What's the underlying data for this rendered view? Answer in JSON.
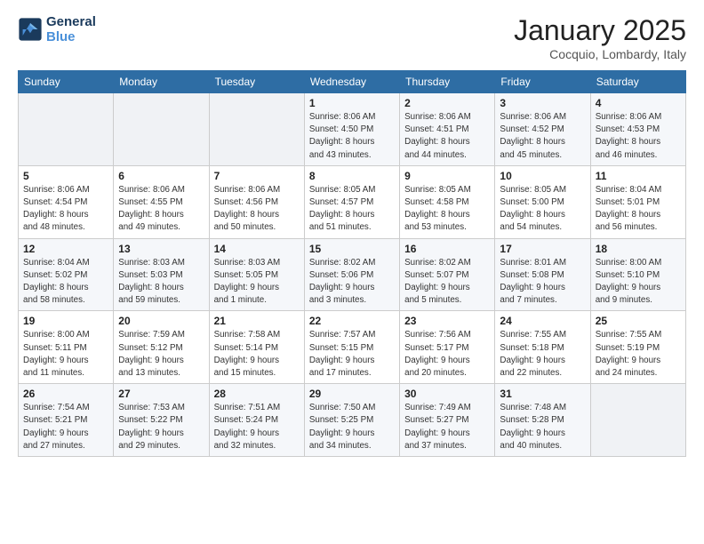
{
  "header": {
    "logo_line1": "General",
    "logo_line2": "Blue",
    "month_title": "January 2025",
    "location": "Cocquio, Lombardy, Italy"
  },
  "weekdays": [
    "Sunday",
    "Monday",
    "Tuesday",
    "Wednesday",
    "Thursday",
    "Friday",
    "Saturday"
  ],
  "weeks": [
    [
      {
        "day": "",
        "info": ""
      },
      {
        "day": "",
        "info": ""
      },
      {
        "day": "",
        "info": ""
      },
      {
        "day": "1",
        "info": "Sunrise: 8:06 AM\nSunset: 4:50 PM\nDaylight: 8 hours\nand 43 minutes."
      },
      {
        "day": "2",
        "info": "Sunrise: 8:06 AM\nSunset: 4:51 PM\nDaylight: 8 hours\nand 44 minutes."
      },
      {
        "day": "3",
        "info": "Sunrise: 8:06 AM\nSunset: 4:52 PM\nDaylight: 8 hours\nand 45 minutes."
      },
      {
        "day": "4",
        "info": "Sunrise: 8:06 AM\nSunset: 4:53 PM\nDaylight: 8 hours\nand 46 minutes."
      }
    ],
    [
      {
        "day": "5",
        "info": "Sunrise: 8:06 AM\nSunset: 4:54 PM\nDaylight: 8 hours\nand 48 minutes."
      },
      {
        "day": "6",
        "info": "Sunrise: 8:06 AM\nSunset: 4:55 PM\nDaylight: 8 hours\nand 49 minutes."
      },
      {
        "day": "7",
        "info": "Sunrise: 8:06 AM\nSunset: 4:56 PM\nDaylight: 8 hours\nand 50 minutes."
      },
      {
        "day": "8",
        "info": "Sunrise: 8:05 AM\nSunset: 4:57 PM\nDaylight: 8 hours\nand 51 minutes."
      },
      {
        "day": "9",
        "info": "Sunrise: 8:05 AM\nSunset: 4:58 PM\nDaylight: 8 hours\nand 53 minutes."
      },
      {
        "day": "10",
        "info": "Sunrise: 8:05 AM\nSunset: 5:00 PM\nDaylight: 8 hours\nand 54 minutes."
      },
      {
        "day": "11",
        "info": "Sunrise: 8:04 AM\nSunset: 5:01 PM\nDaylight: 8 hours\nand 56 minutes."
      }
    ],
    [
      {
        "day": "12",
        "info": "Sunrise: 8:04 AM\nSunset: 5:02 PM\nDaylight: 8 hours\nand 58 minutes."
      },
      {
        "day": "13",
        "info": "Sunrise: 8:03 AM\nSunset: 5:03 PM\nDaylight: 8 hours\nand 59 minutes."
      },
      {
        "day": "14",
        "info": "Sunrise: 8:03 AM\nSunset: 5:05 PM\nDaylight: 9 hours\nand 1 minute."
      },
      {
        "day": "15",
        "info": "Sunrise: 8:02 AM\nSunset: 5:06 PM\nDaylight: 9 hours\nand 3 minutes."
      },
      {
        "day": "16",
        "info": "Sunrise: 8:02 AM\nSunset: 5:07 PM\nDaylight: 9 hours\nand 5 minutes."
      },
      {
        "day": "17",
        "info": "Sunrise: 8:01 AM\nSunset: 5:08 PM\nDaylight: 9 hours\nand 7 minutes."
      },
      {
        "day": "18",
        "info": "Sunrise: 8:00 AM\nSunset: 5:10 PM\nDaylight: 9 hours\nand 9 minutes."
      }
    ],
    [
      {
        "day": "19",
        "info": "Sunrise: 8:00 AM\nSunset: 5:11 PM\nDaylight: 9 hours\nand 11 minutes."
      },
      {
        "day": "20",
        "info": "Sunrise: 7:59 AM\nSunset: 5:12 PM\nDaylight: 9 hours\nand 13 minutes."
      },
      {
        "day": "21",
        "info": "Sunrise: 7:58 AM\nSunset: 5:14 PM\nDaylight: 9 hours\nand 15 minutes."
      },
      {
        "day": "22",
        "info": "Sunrise: 7:57 AM\nSunset: 5:15 PM\nDaylight: 9 hours\nand 17 minutes."
      },
      {
        "day": "23",
        "info": "Sunrise: 7:56 AM\nSunset: 5:17 PM\nDaylight: 9 hours\nand 20 minutes."
      },
      {
        "day": "24",
        "info": "Sunrise: 7:55 AM\nSunset: 5:18 PM\nDaylight: 9 hours\nand 22 minutes."
      },
      {
        "day": "25",
        "info": "Sunrise: 7:55 AM\nSunset: 5:19 PM\nDaylight: 9 hours\nand 24 minutes."
      }
    ],
    [
      {
        "day": "26",
        "info": "Sunrise: 7:54 AM\nSunset: 5:21 PM\nDaylight: 9 hours\nand 27 minutes."
      },
      {
        "day": "27",
        "info": "Sunrise: 7:53 AM\nSunset: 5:22 PM\nDaylight: 9 hours\nand 29 minutes."
      },
      {
        "day": "28",
        "info": "Sunrise: 7:51 AM\nSunset: 5:24 PM\nDaylight: 9 hours\nand 32 minutes."
      },
      {
        "day": "29",
        "info": "Sunrise: 7:50 AM\nSunset: 5:25 PM\nDaylight: 9 hours\nand 34 minutes."
      },
      {
        "day": "30",
        "info": "Sunrise: 7:49 AM\nSunset: 5:27 PM\nDaylight: 9 hours\nand 37 minutes."
      },
      {
        "day": "31",
        "info": "Sunrise: 7:48 AM\nSunset: 5:28 PM\nDaylight: 9 hours\nand 40 minutes."
      },
      {
        "day": "",
        "info": ""
      }
    ]
  ]
}
